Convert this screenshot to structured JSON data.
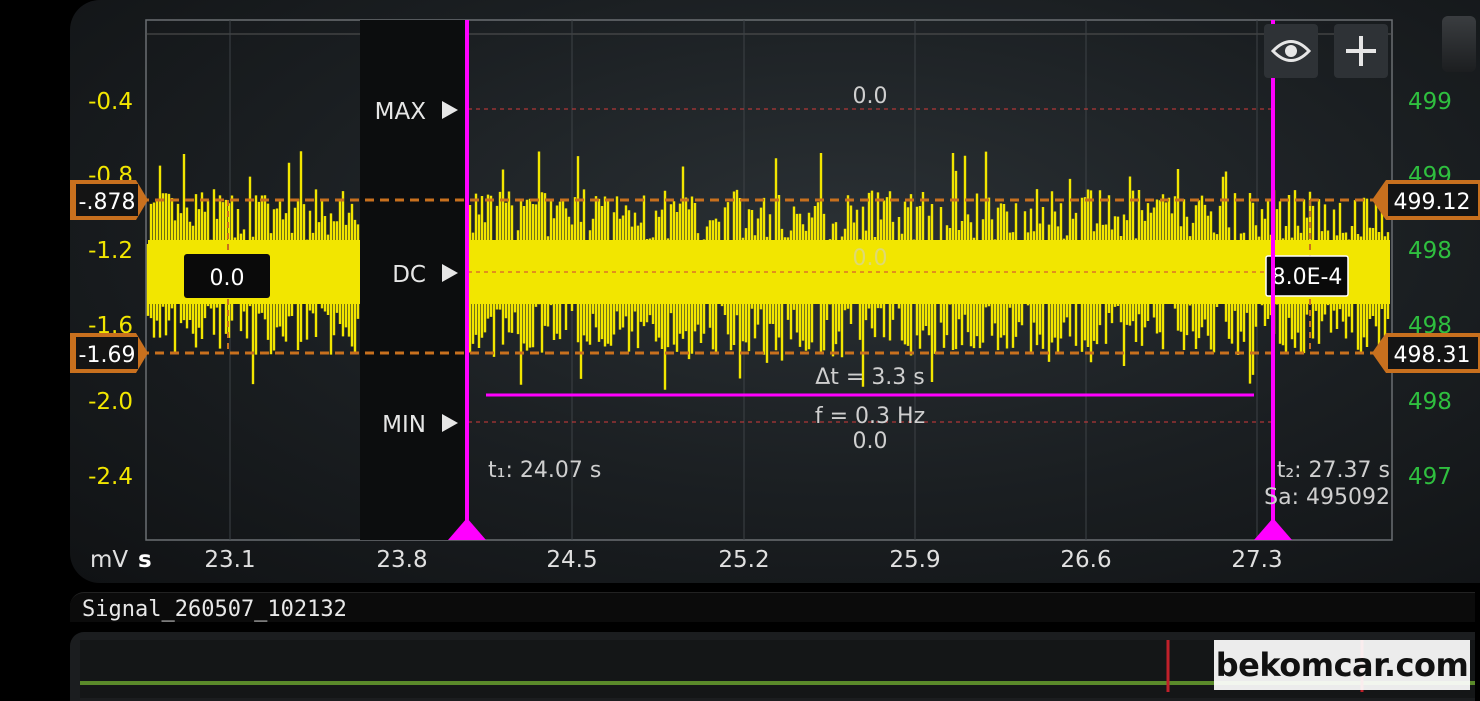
{
  "colors": {
    "signal": "#f2e600",
    "cursor": "#e01ee0",
    "cursor_line": "#ff00ff",
    "level_line": "#c8701e",
    "scale_right": "#2fbf3f",
    "guide": "#d23a3a"
  },
  "axis": {
    "unit_left": "mV",
    "unit_time": "s",
    "time_ticks": [
      "23.1",
      "23.8",
      "24.5",
      "25.2",
      "25.9",
      "26.6",
      "27.3"
    ],
    "left_ticks": [
      "-0.4",
      "-0.8",
      "-1.2",
      "-1.6",
      "-2.0",
      "-2.4"
    ],
    "right_ticks": [
      "499",
      "499",
      "498",
      "498",
      "498",
      "497"
    ]
  },
  "markers": {
    "max_label": "MAX",
    "dc_label": "DC",
    "min_label": "MIN",
    "max_value": "0.0",
    "dc_value": "0.0",
    "min_value": "0.0"
  },
  "levels": {
    "upper_left": "-.878",
    "lower_left": "-1.69",
    "upper_right": "499.12",
    "lower_right": "498.31",
    "box_left": "0.0",
    "box_right": "8.0E-4"
  },
  "cursors": {
    "t1": "t₁: 24.07 s",
    "t2": "t₂: 27.37 s",
    "samples": "Sa: 495092",
    "delta_t": "Δt = 3.3 s",
    "freq": "f = 0.3 Hz"
  },
  "icons": {
    "eye": "eye-icon",
    "plus": "plus-icon"
  },
  "file": {
    "name": "Signal_260507_102132"
  },
  "watermark": "bekomcar.com"
}
